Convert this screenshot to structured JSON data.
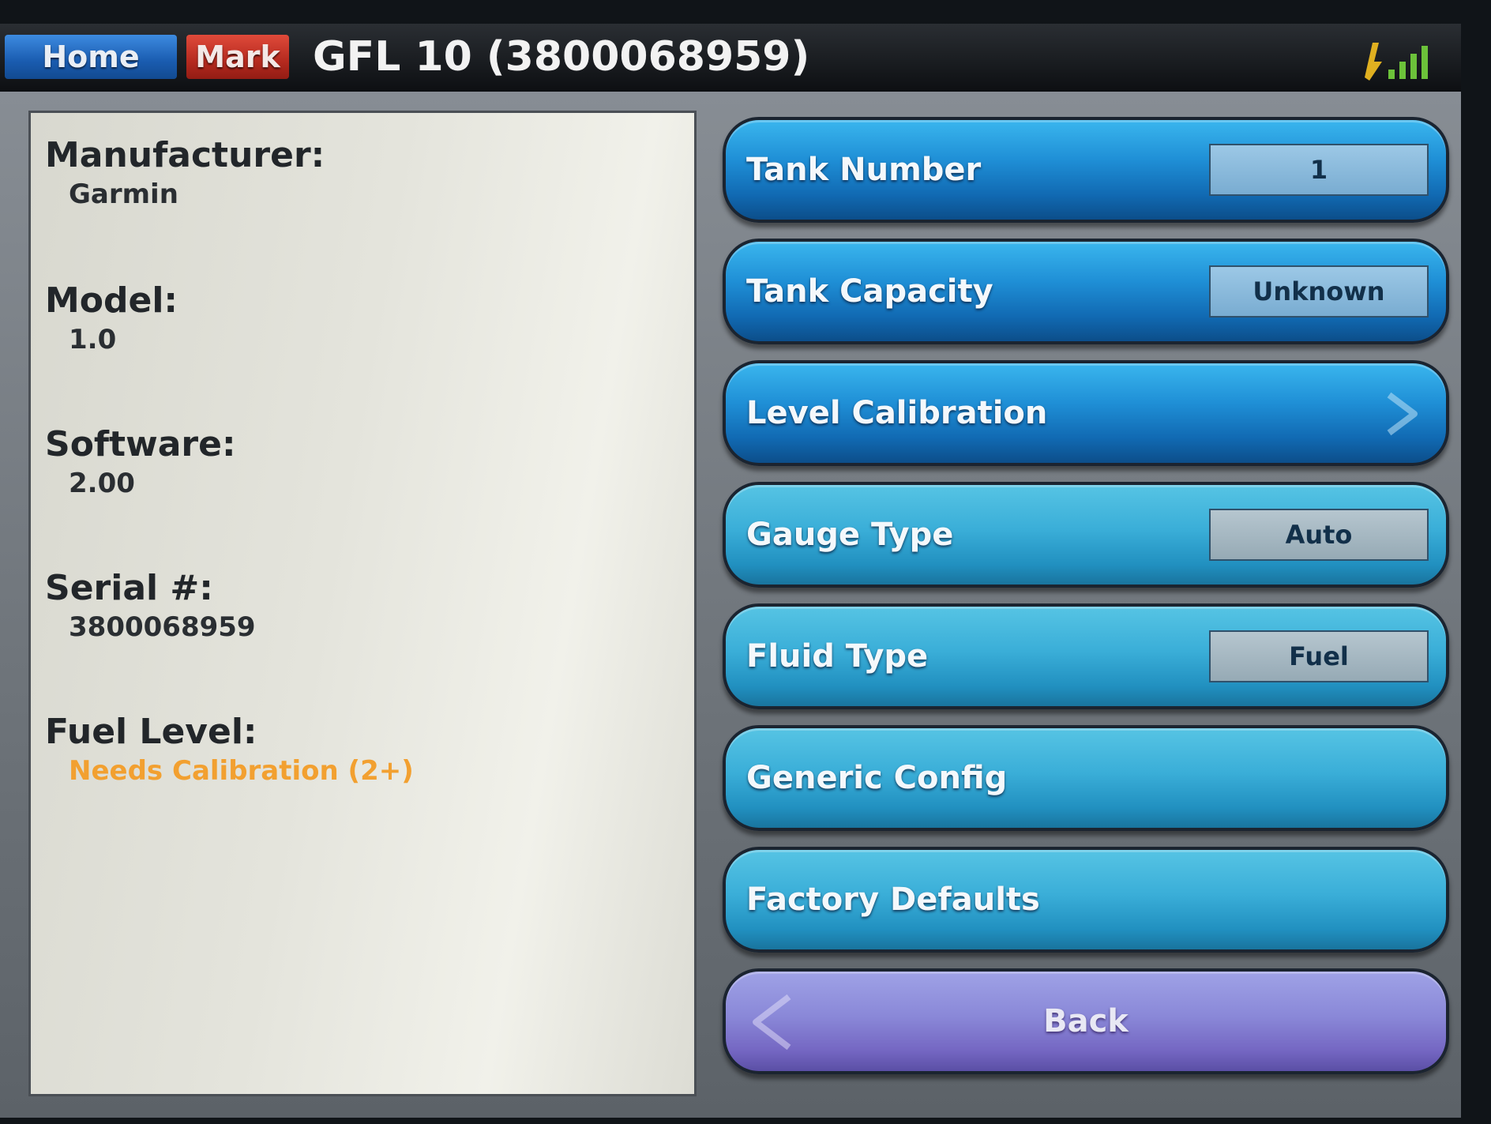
{
  "topbar": {
    "home_label": "Home",
    "mark_label": "Mark",
    "title": "GFL 10 (3800068959)",
    "signal_icon": "signal-strength-icon"
  },
  "info": {
    "manufacturer_label": "Manufacturer:",
    "manufacturer_value": "Garmin",
    "model_label": "Model:",
    "model_value": "1.0",
    "software_label": "Software:",
    "software_value": "2.00",
    "serial_label": "Serial #:",
    "serial_value": "3800068959",
    "fuel_label": "Fuel Level:",
    "fuel_value": "Needs Calibration (2+)"
  },
  "menu": {
    "tank_number_label": "Tank Number",
    "tank_number_value": "1",
    "tank_capacity_label": "Tank Capacity",
    "tank_capacity_value": "Unknown",
    "level_calibration_label": "Level Calibration",
    "gauge_type_label": "Gauge Type",
    "gauge_type_value": "Auto",
    "fluid_type_label": "Fluid Type",
    "fluid_type_value": "Fuel",
    "generic_config_label": "Generic Config",
    "factory_defaults_label": "Factory Defaults",
    "back_label": "Back"
  },
  "colors": {
    "warning": "#f2a030",
    "home": "#1a5cb0",
    "mark": "#b52a1f",
    "menu_blue": "#1f8fd6",
    "menu_cyan": "#3aaed8",
    "back_purple": "#8a88d8"
  }
}
